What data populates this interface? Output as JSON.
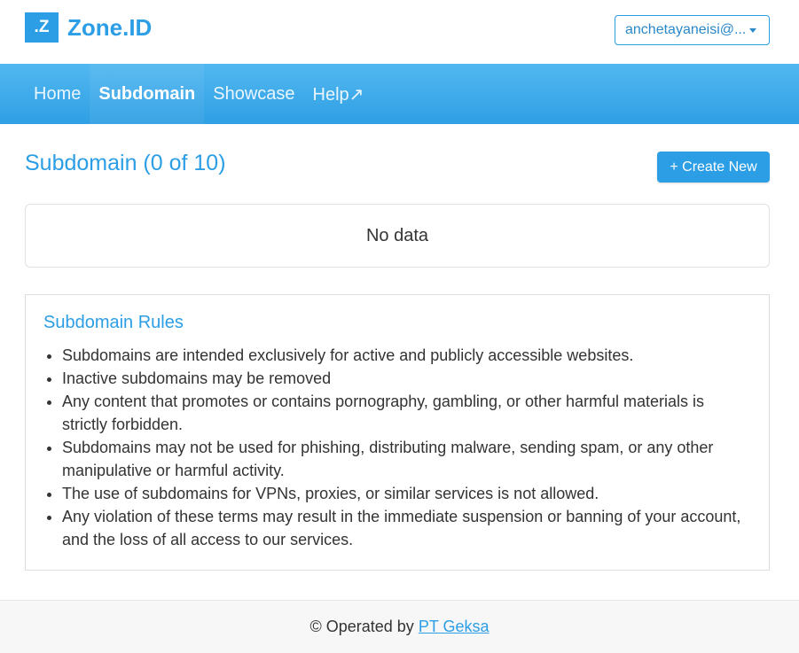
{
  "header": {
    "logo_mark": ".Z",
    "logo_text": "Zone.ID",
    "account_label": "anchetayaneisi@..."
  },
  "nav": {
    "items": [
      {
        "label": "Home"
      },
      {
        "label": "Subdomain",
        "active": true
      },
      {
        "label": "Showcase"
      },
      {
        "label": "Help↗"
      }
    ]
  },
  "main": {
    "title": "Subdomain (0 of 10)",
    "create_button": "+ Create New",
    "empty_text": "No data"
  },
  "rules": {
    "title": "Subdomain Rules",
    "items": [
      "Subdomains are intended exclusively for active and publicly accessible websites.",
      "Inactive subdomains may be removed",
      "Any content that promotes or contains pornography, gambling, or other harmful materials is strictly forbidden.",
      "Subdomains may not be used for phishing, distributing malware, sending spam, or any other manipulative or harmful activity.",
      "The use of subdomains for VPNs, proxies, or similar services is not allowed.",
      "Any violation of these terms may result in the immediate suspension or banning of your account, and the loss of all access to our services."
    ]
  },
  "footer": {
    "prefix": "© Operated by",
    "link_text": "PT Geksa"
  },
  "colors": {
    "accent": "#2b9ee6",
    "nav_gradient_top": "#52b8f0",
    "nav_gradient_bottom": "#2f9fe4"
  }
}
